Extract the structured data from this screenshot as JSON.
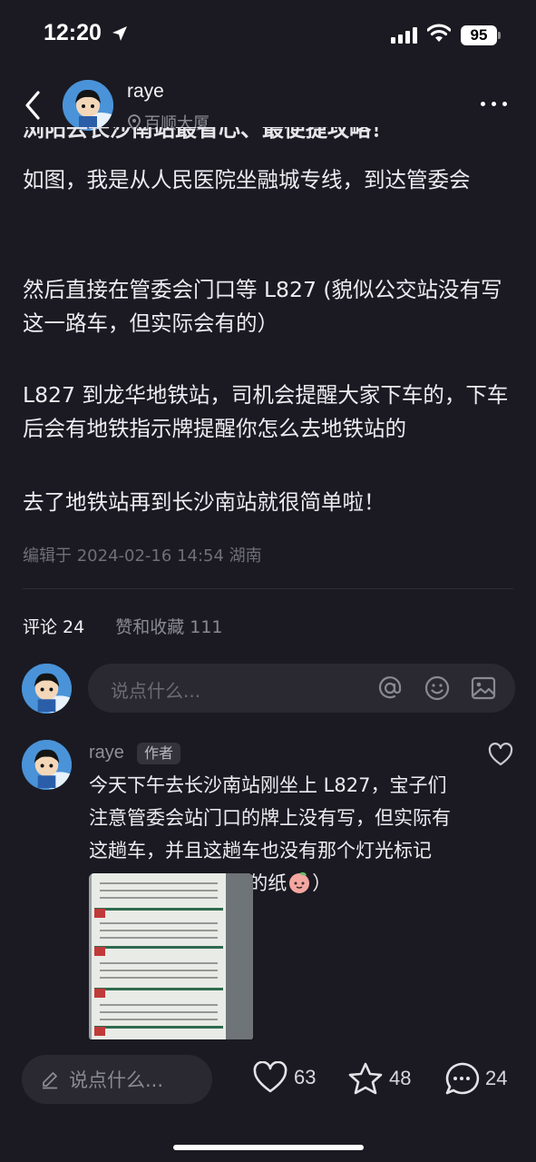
{
  "status": {
    "time": "12:20",
    "battery": "95"
  },
  "header": {
    "author": "raye",
    "location": "百顺大厦"
  },
  "article": {
    "partial_title": "浏阳去长沙南站最省心、最便捷攻略！",
    "paragraphs": [
      "如图，我是从人民医院坐融城专线，到达管委会",
      "然后直接在管委会门口等 L827 (貌似公交站没有写这一路车，但实际会有的）",
      "L827 到龙华地铁站，司机会提醒大家下车的，下车后会有地铁指示牌提醒你怎么去地铁站的",
      "去了地铁站再到长沙南站就很简单啦！"
    ],
    "edited": "编辑于 2024-02-16 14:54 湖南"
  },
  "tabs": {
    "comments": "评论 24",
    "likes": "赞和收藏 111"
  },
  "comment_input": {
    "placeholder": "说点什么..."
  },
  "comment": {
    "name": "raye",
    "badge": "作者",
    "text": "今天下午去长沙南站刚坐上 L827，宝子们注意管委会站门口的牌上没有写，但实际有这趟车，并且这趟车也没有那个灯光标记 (车窗前有一张简陋的纸",
    "text_end": "）"
  },
  "bottom": {
    "placeholder": "说点什么...",
    "likes": "63",
    "stars": "48",
    "comments": "24"
  },
  "colors": {
    "background": "#1b1a22",
    "input": "#2a2931",
    "muted": "#8a8a92"
  }
}
